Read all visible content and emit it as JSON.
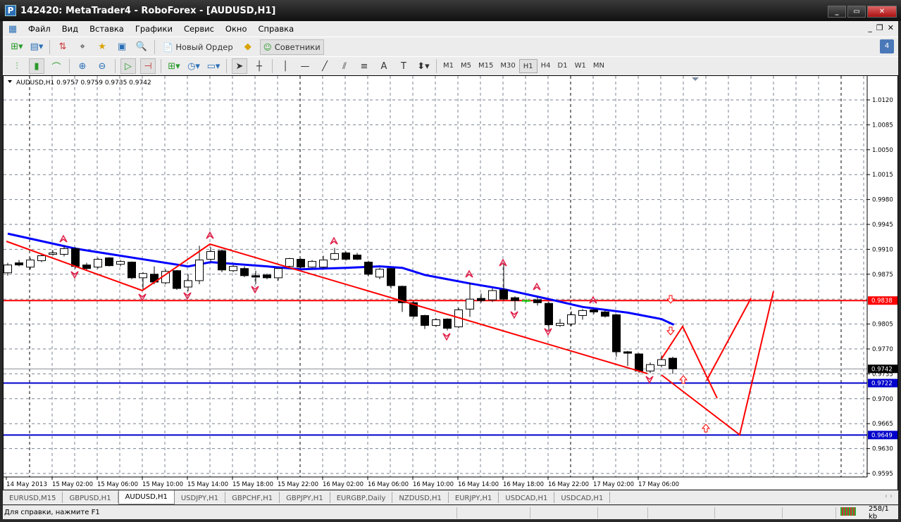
{
  "window": {
    "title": "142420: MetaTrader4 - RoboForex - [AUDUSD,H1]"
  },
  "menu": [
    "Файл",
    "Вид",
    "Вставка",
    "Графики",
    "Сервис",
    "Окно",
    "Справка"
  ],
  "toolbar": {
    "new_order": "Новый Ордер",
    "experts": "Советники",
    "experts_count": "4"
  },
  "timeframes": [
    "M1",
    "M5",
    "M15",
    "M30",
    "H1",
    "H4",
    "D1",
    "W1",
    "MN"
  ],
  "active_timeframe": "H1",
  "chart": {
    "header": "AUDUSD,H1  0.9757 0.9759 0.9735 0.9742",
    "price_max": 1.012,
    "price_min": 0.9595,
    "price_labels": [
      "1.0120",
      "1.0085",
      "1.0050",
      "1.0015",
      "0.9980",
      "0.9945",
      "0.9910",
      "0.9875",
      "0.9805",
      "0.9770",
      "0.9735",
      "0.9700",
      "0.9665",
      "0.9630",
      "0.9595"
    ],
    "hlines": [
      {
        "price": 0.9838,
        "label": "0.9838",
        "color": "#ff0000"
      },
      {
        "price": 0.9722,
        "label": "0.9722",
        "color": "#0000cc"
      },
      {
        "price": 0.9649,
        "label": "0.9649",
        "color": "#0000cc"
      }
    ],
    "bid": {
      "price": 0.9742,
      "label": "0.9742"
    },
    "time_labels": [
      "14 May 2013",
      "15 May 02:00",
      "15 May 06:00",
      "15 May 10:00",
      "15 May 14:00",
      "15 May 18:00",
      "15 May 22:00",
      "16 May 02:00",
      "16 May 06:00",
      "16 May 10:00",
      "16 May 14:00",
      "16 May 18:00",
      "16 May 22:00",
      "17 May 02:00",
      "17 May 06:00"
    ],
    "candles": [
      [
        0.9877,
        0.9891,
        0.9873,
        0.9888
      ],
      [
        0.9891,
        0.9895,
        0.9886,
        0.9888
      ],
      [
        0.9885,
        0.9898,
        0.9882,
        0.9895
      ],
      [
        0.9894,
        0.9903,
        0.9892,
        0.9901
      ],
      [
        0.9903,
        0.9909,
        0.9901,
        0.9905
      ],
      [
        0.9903,
        0.9915,
        0.99,
        0.9911
      ],
      [
        0.9911,
        0.9913,
        0.9883,
        0.9886
      ],
      [
        0.9888,
        0.9891,
        0.9881,
        0.9883
      ],
      [
        0.9885,
        0.9898,
        0.9883,
        0.9896
      ],
      [
        0.9898,
        0.9899,
        0.9886,
        0.9887
      ],
      [
        0.9889,
        0.9895,
        0.9886,
        0.9893
      ],
      [
        0.9892,
        0.9893,
        0.9868,
        0.987
      ],
      [
        0.987,
        0.9878,
        0.9853,
        0.9876
      ],
      [
        0.9875,
        0.9886,
        0.9861,
        0.9864
      ],
      [
        0.9863,
        0.9882,
        0.9861,
        0.9879
      ],
      [
        0.988,
        0.9881,
        0.9853,
        0.9855
      ],
      [
        0.9857,
        0.9875,
        0.9851,
        0.9866
      ],
      [
        0.9866,
        0.9915,
        0.9861,
        0.9895
      ],
      [
        0.9896,
        0.9913,
        0.9893,
        0.9907
      ],
      [
        0.9908,
        0.991,
        0.9878,
        0.9881
      ],
      [
        0.988,
        0.9888,
        0.9878,
        0.9886
      ],
      [
        0.9883,
        0.9886,
        0.9871,
        0.9873
      ],
      [
        0.9873,
        0.988,
        0.9861,
        0.9871
      ],
      [
        0.9874,
        0.9876,
        0.9868,
        0.987
      ],
      [
        0.987,
        0.9884,
        0.9866,
        0.9883
      ],
      [
        0.9886,
        0.9898,
        0.9885,
        0.9897
      ],
      [
        0.9896,
        0.9897,
        0.9884,
        0.9885
      ],
      [
        0.9885,
        0.9895,
        0.9884,
        0.9893
      ],
      [
        0.9885,
        0.9901,
        0.9883,
        0.9895
      ],
      [
        0.9896,
        0.9912,
        0.9894,
        0.9904
      ],
      [
        0.9905,
        0.9907,
        0.9894,
        0.9896
      ],
      [
        0.9902,
        0.9905,
        0.9895,
        0.9896
      ],
      [
        0.9892,
        0.9894,
        0.9872,
        0.9875
      ],
      [
        0.9871,
        0.9884,
        0.9868,
        0.9882
      ],
      [
        0.9883,
        0.9884,
        0.9855,
        0.9859
      ],
      [
        0.9858,
        0.9859,
        0.9822,
        0.9835
      ],
      [
        0.9835,
        0.9837,
        0.9813,
        0.9816
      ],
      [
        0.9817,
        0.9818,
        0.9798,
        0.9803
      ],
      [
        0.9803,
        0.9813,
        0.9801,
        0.9811
      ],
      [
        0.9812,
        0.9813,
        0.9796,
        0.9799
      ],
      [
        0.9801,
        0.9828,
        0.9799,
        0.9825
      ],
      [
        0.9826,
        0.9863,
        0.9815,
        0.984
      ],
      [
        0.9841,
        0.9848,
        0.9835,
        0.9838
      ],
      [
        0.9839,
        0.9855,
        0.9836,
        0.9852
      ],
      [
        0.9853,
        0.989,
        0.9838,
        0.984
      ],
      [
        0.9842,
        0.9844,
        0.9824,
        0.9838
      ],
      [
        0.9838,
        0.9841,
        0.9835,
        0.9838
      ],
      [
        0.9839,
        0.9843,
        0.9831,
        0.9835
      ],
      [
        0.9834,
        0.9836,
        0.9797,
        0.9804
      ],
      [
        0.9803,
        0.9812,
        0.9801,
        0.9806
      ],
      [
        0.9805,
        0.9823,
        0.9802,
        0.9818
      ],
      [
        0.9817,
        0.9826,
        0.9811,
        0.9824
      ],
      [
        0.9825,
        0.9826,
        0.9819,
        0.9822
      ],
      [
        0.9822,
        0.9824,
        0.9814,
        0.9816
      ],
      [
        0.9818,
        0.9819,
        0.9759,
        0.9766
      ],
      [
        0.9766,
        0.9767,
        0.9746,
        0.9764
      ],
      [
        0.9763,
        0.9764,
        0.9736,
        0.9739
      ],
      [
        0.9739,
        0.9751,
        0.9736,
        0.9748
      ],
      [
        0.9747,
        0.9761,
        0.9744,
        0.9755
      ],
      [
        0.9757,
        0.9759,
        0.9735,
        0.9742
      ]
    ],
    "ma": [
      [
        0,
        0.9932
      ],
      [
        6,
        0.9911
      ],
      [
        12,
        0.9896
      ],
      [
        16,
        0.9886
      ],
      [
        18,
        0.9892
      ],
      [
        23,
        0.9886
      ],
      [
        26,
        0.9882
      ],
      [
        30,
        0.9884
      ],
      [
        33,
        0.9886
      ],
      [
        35,
        0.9884
      ],
      [
        37,
        0.9874
      ],
      [
        41,
        0.9862
      ],
      [
        44,
        0.9854
      ],
      [
        48,
        0.984
      ],
      [
        51,
        0.9829
      ],
      [
        55,
        0.9821
      ],
      [
        58,
        0.9812
      ],
      [
        59.1,
        0.9804
      ]
    ],
    "colors": {
      "ma": "#0000ff",
      "zigzag": "#ff0000",
      "fractal": "#e0204a"
    }
  },
  "tabs": [
    "EURUSD,M15",
    "GBPUSD,H1",
    "AUDUSD,H1",
    "USDJPY,H1",
    "GBPCHF,H1",
    "GBPJPY,H1",
    "EURGBP,Daily",
    "NZDUSD,H1",
    "EURJPY,H1",
    "USDCAD,H1",
    "USDCAD,H1"
  ],
  "active_tab": "AUDUSD,H1",
  "status": {
    "help": "Для справки, нажмите F1",
    "traffic": "258/1 kb"
  }
}
